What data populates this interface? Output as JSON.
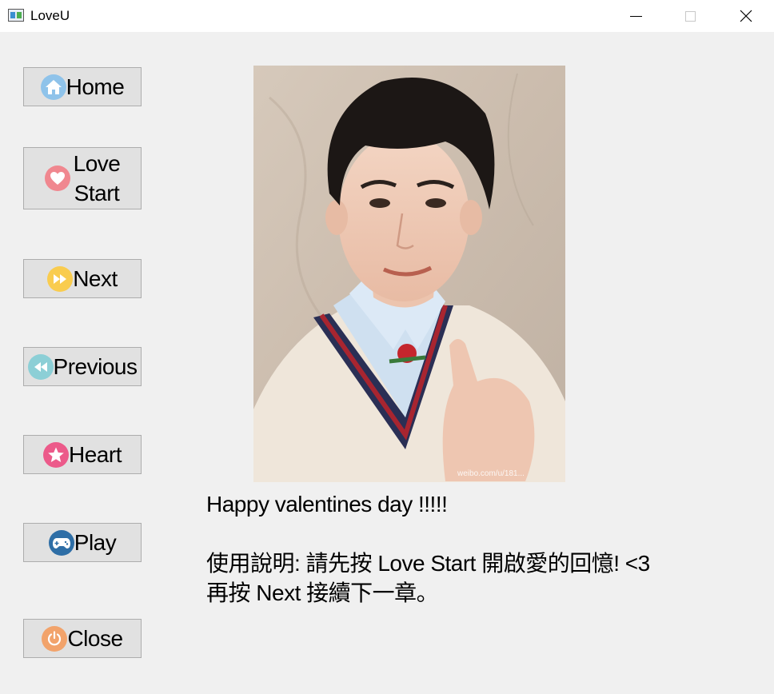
{
  "window": {
    "title": "LoveU",
    "icon": "app-window-icon"
  },
  "nav": {
    "home": {
      "label": "Home",
      "icon": "house-icon"
    },
    "love_start": {
      "label": "Love\nStart",
      "icon": "heart-circle-icon"
    },
    "next": {
      "label": "Next",
      "icon": "fast-forward-icon"
    },
    "previous": {
      "label": "Previous",
      "icon": "rewind-icon"
    },
    "heart": {
      "label": "Heart",
      "icon": "star-icon"
    },
    "play": {
      "label": "Play",
      "icon": "gamepad-icon"
    },
    "close": {
      "label": "Close",
      "icon": "power-icon"
    }
  },
  "photo": {
    "watermark": "weibo.com/u/181..."
  },
  "message": {
    "line1": "Happy valentines day !!!!!",
    "line2": "使用說明: 請先按 Love Start 開啟愛的回憶! <3",
    "line3": "再按 Next 接續下一章。"
  },
  "colors": {
    "window_bg": "#f0f0f0",
    "button_bg": "#e1e1e1",
    "button_border": "#adadad"
  }
}
